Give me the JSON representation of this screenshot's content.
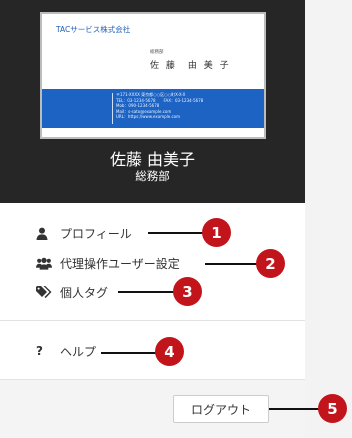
{
  "card": {
    "company": "TACサービス株式会社",
    "dept": "総務部",
    "name": "佐 藤　由 美 子",
    "lines": [
      "〒171-XXXX 東京都○○区○○町X-X-X",
      "TEL：03-1234-5678　　FAX：03-1234-5678",
      "Mob：090-1234-5678",
      "Mail：s-sato@example.com",
      "URL：https://www.example.com"
    ]
  },
  "user": {
    "name": "佐藤 由美子",
    "dept": "総務部"
  },
  "menu": {
    "profile": {
      "label": "プロフィール",
      "icon": "person-icon"
    },
    "delegate": {
      "label": "代理操作ユーザー設定",
      "icon": "users-icon"
    },
    "tags": {
      "label": "個人タグ",
      "icon": "tags-icon"
    },
    "help": {
      "label": "ヘルプ",
      "icon": "question-mark-icon",
      "glyph": "?"
    }
  },
  "logout_label": "ログアウト",
  "callouts": [
    "1",
    "2",
    "3",
    "4",
    "5"
  ],
  "colors": {
    "header_bg": "#262626",
    "card_band": "#1c63c4",
    "callout": "#c2141b"
  }
}
